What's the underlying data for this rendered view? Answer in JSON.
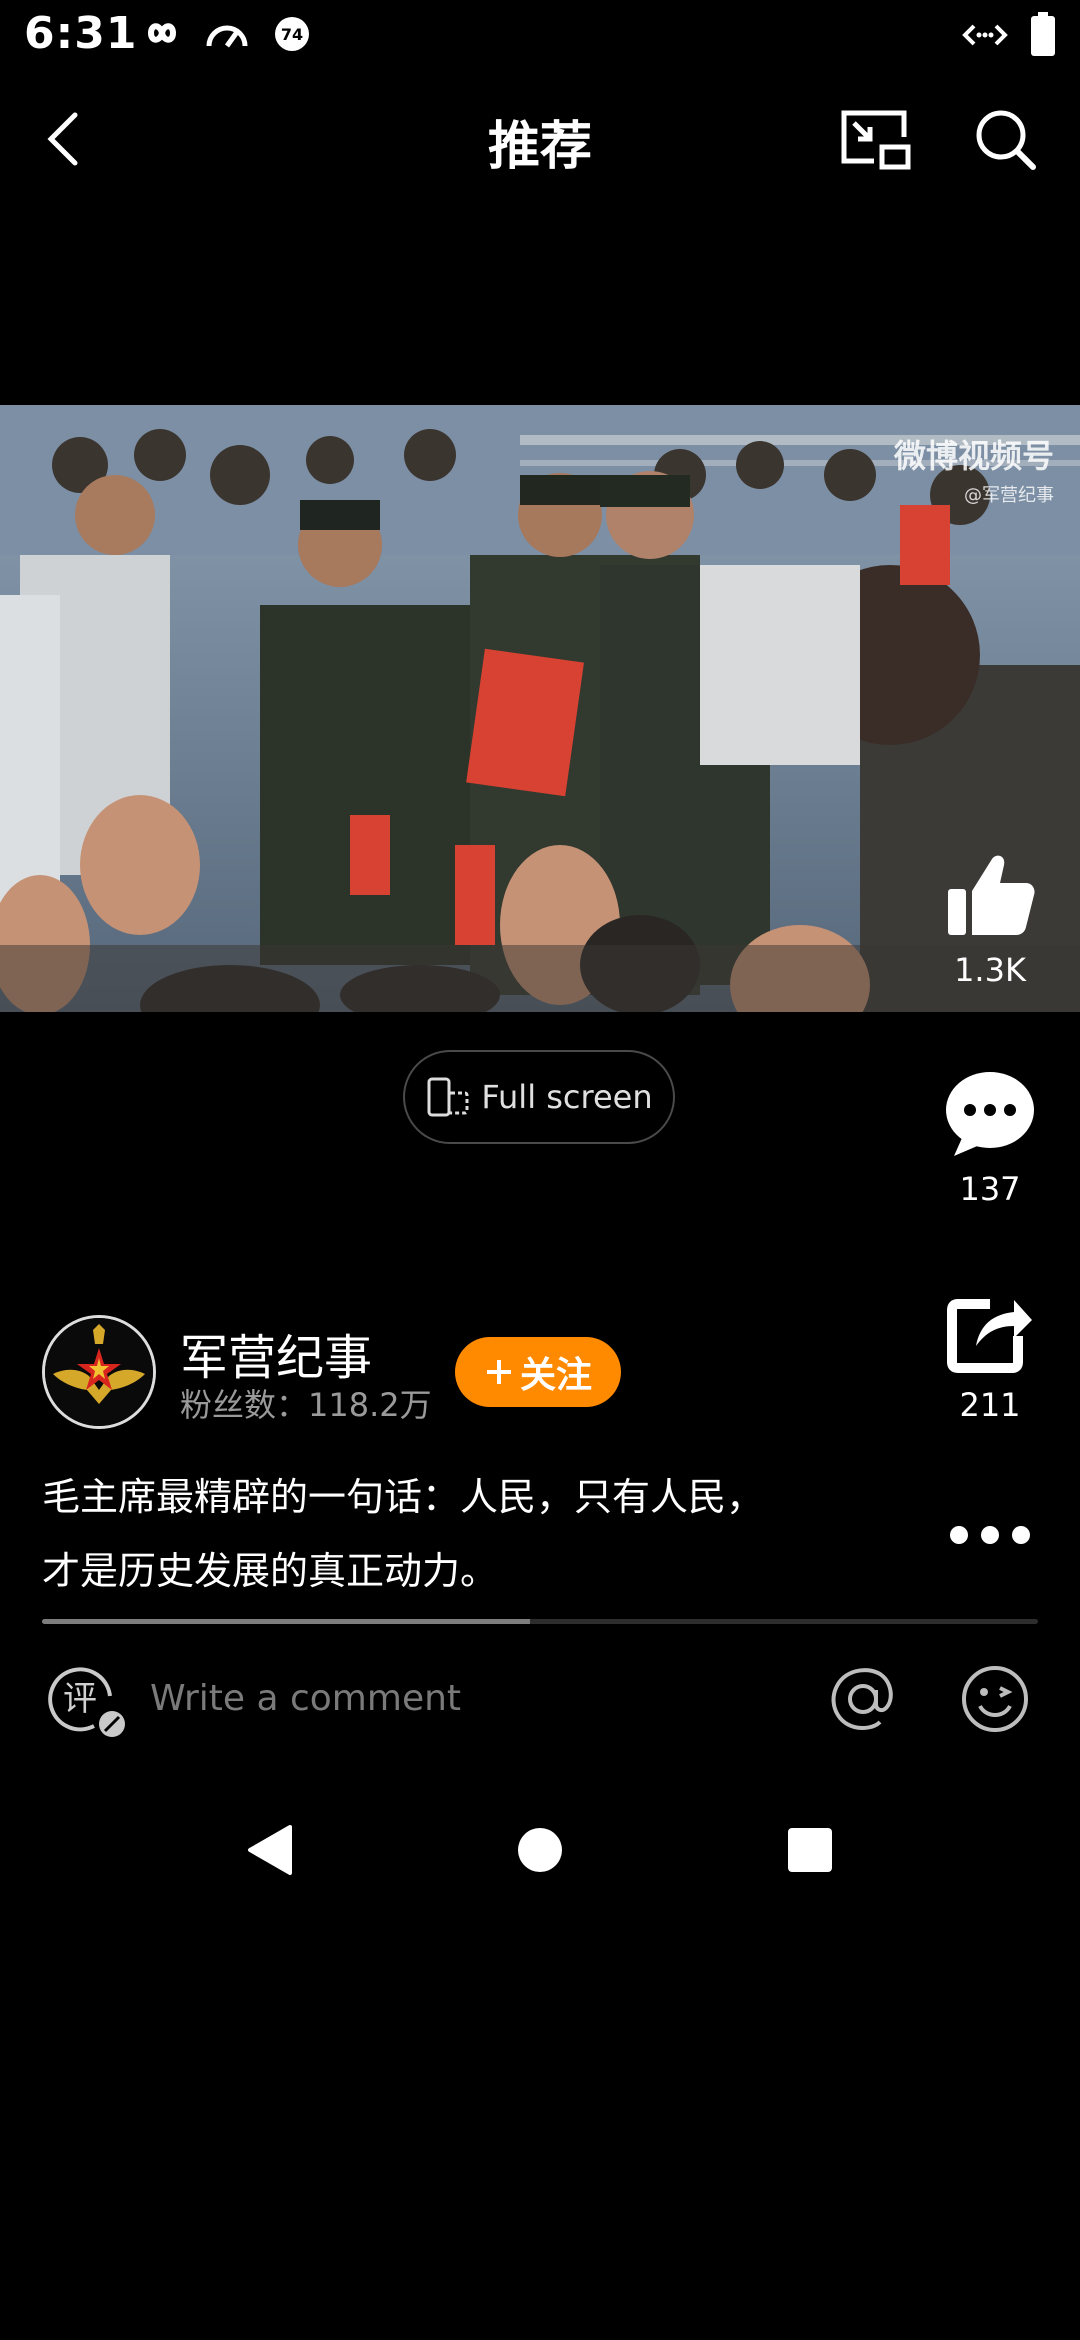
{
  "status_bar": {
    "time": "6:31",
    "icons": [
      "infinity-icon",
      "speedometer-icon",
      "notification-74-icon",
      "code-arrows-icon",
      "battery-icon"
    ],
    "badge": "74"
  },
  "header": {
    "title": "推荐",
    "icons": [
      "back-icon",
      "picture-in-picture-icon",
      "search-icon"
    ]
  },
  "video": {
    "watermark_main": "微博视频号",
    "watermark_sub": "@军营纪事"
  },
  "fullscreen_button": {
    "label": "Full screen"
  },
  "actions": {
    "like_count": "1.3K",
    "comment_count": "137",
    "share_count": "211"
  },
  "author": {
    "name": "军营纪事",
    "fans": "粉丝数：118.2万",
    "follow_label": "关注"
  },
  "caption": {
    "line1": "毛主席最精辟的一句话：人民，只有人民，",
    "line2": "才是历史发展的真正动力。"
  },
  "progress": {
    "fraction": 0.49
  },
  "comment_bar": {
    "placeholder": "Write a comment",
    "badge_char": "评"
  },
  "colors": {
    "background": "#000000",
    "accent": "#ff8a00",
    "muted_text": "#9a9a9a"
  }
}
